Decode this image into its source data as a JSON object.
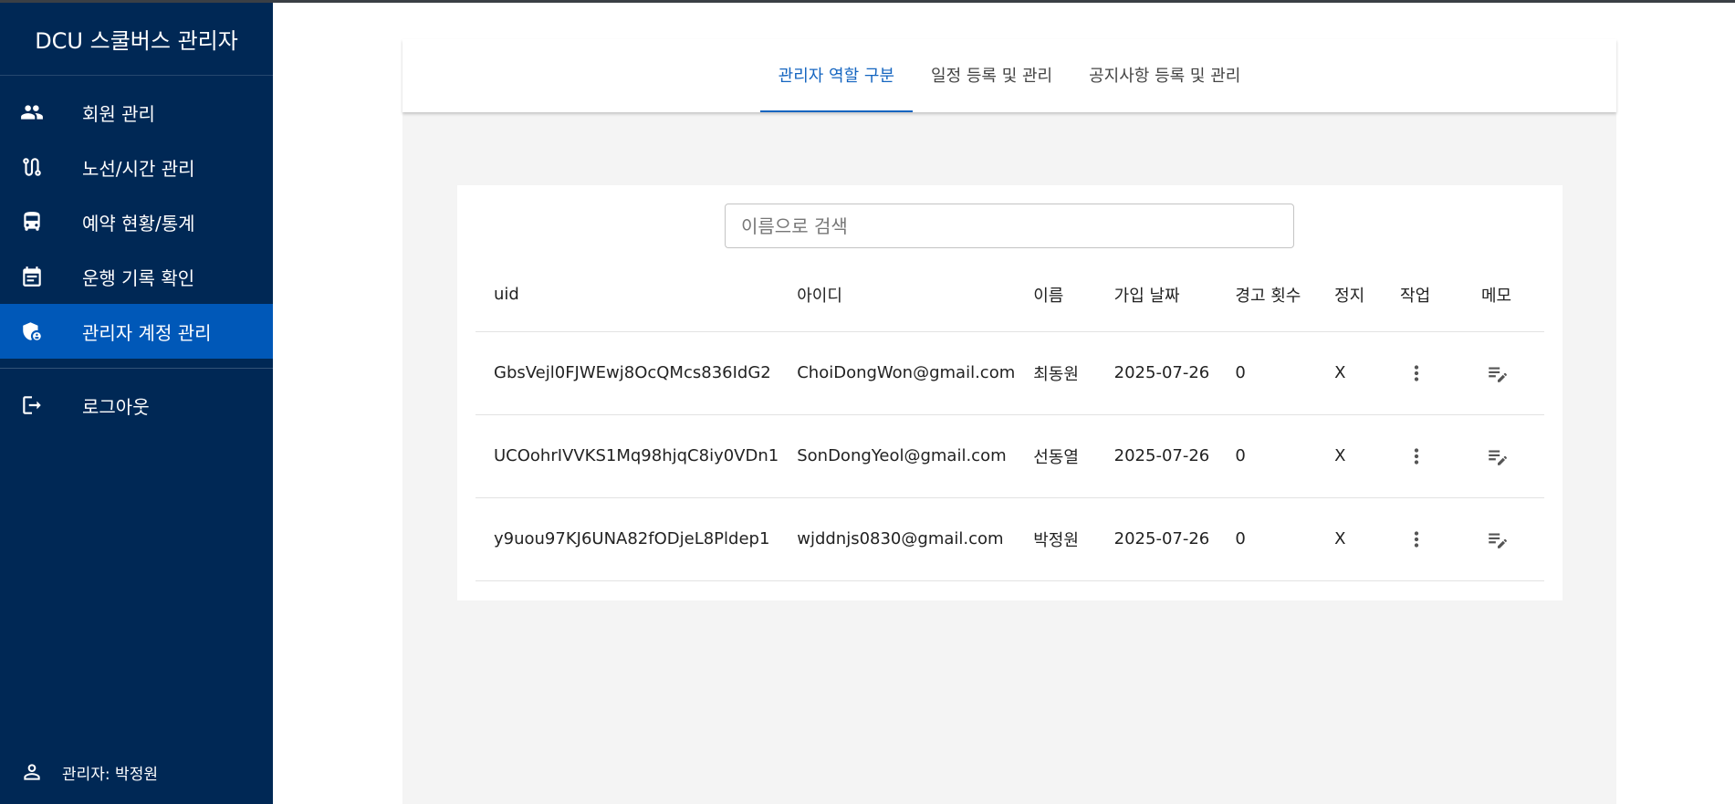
{
  "app": {
    "title": "DCU 스쿨버스 관리자"
  },
  "sidebar": {
    "items": [
      {
        "label": "회원 관리",
        "icon": "people-icon"
      },
      {
        "label": "노선/시간 관리",
        "icon": "route-icon"
      },
      {
        "label": "예약 현황/통계",
        "icon": "bus-icon"
      },
      {
        "label": "운행 기록 확인",
        "icon": "calendar-icon"
      },
      {
        "label": "관리자 계정 관리",
        "icon": "admin-shield-icon",
        "active": true
      }
    ],
    "logout_label": "로그아웃",
    "footer_user": "관리자: 박정원"
  },
  "tabs": [
    {
      "label": "관리자 역할 구분",
      "active": true
    },
    {
      "label": "일정 등록 및 관리",
      "active": false
    },
    {
      "label": "공지사항 등록 및 관리",
      "active": false
    }
  ],
  "search": {
    "placeholder": "이름으로 검색",
    "value": ""
  },
  "table": {
    "headers": [
      "uid",
      "아이디",
      "이름",
      "가입 날짜",
      "경고 횟수",
      "정지",
      "작업",
      "메모"
    ],
    "rows": [
      {
        "uid": "GbsVejl0FJWEwj8OcQMcs836IdG2",
        "email": "ChoiDongWon@gmail.com",
        "name": "최동원",
        "joined": "2025-07-26",
        "warnings": "0",
        "suspended": "X"
      },
      {
        "uid": "UCOohrIVVKS1Mq98hjqC8iy0VDn1",
        "email": "SonDongYeol@gmail.com",
        "name": "선동열",
        "joined": "2025-07-26",
        "warnings": "0",
        "suspended": "X"
      },
      {
        "uid": "y9uou97KJ6UNA82fODjeL8Pldep1",
        "email": "wjddnjs0830@gmail.com",
        "name": "박정원",
        "joined": "2025-07-26",
        "warnings": "0",
        "suspended": "X"
      }
    ]
  },
  "colors": {
    "sidebar_bg": "#002855",
    "sidebar_active": "#0058b8",
    "accent": "#1565c0",
    "panel_bg": "#f4f4f4"
  }
}
